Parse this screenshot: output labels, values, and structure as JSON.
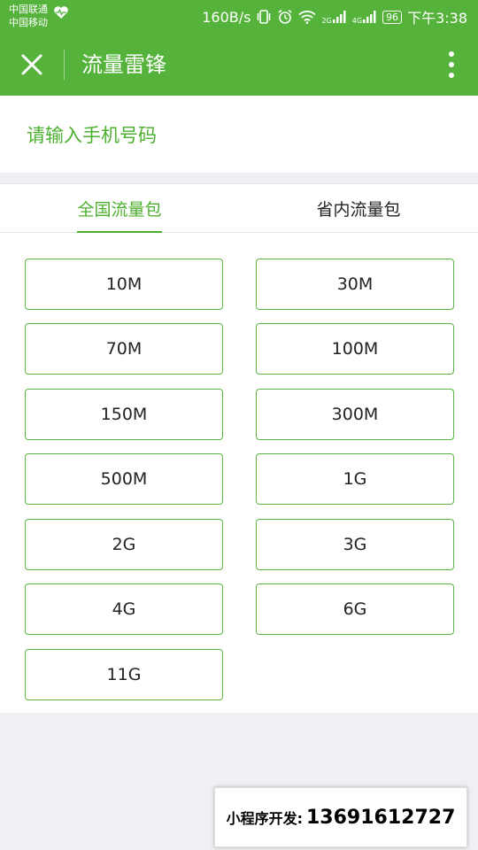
{
  "status_bar": {
    "carrier_1": "中国联通",
    "carrier_2": "中国移动",
    "net_speed": "160B/s",
    "net_type_1": "2G",
    "net_type_2": "4G",
    "battery": "96",
    "time": "下午3:38"
  },
  "navbar": {
    "title": "流量雷锋"
  },
  "phone": {
    "placeholder": "请输入手机号码",
    "value": ""
  },
  "tabs": [
    {
      "label": "全国流量包",
      "active": true
    },
    {
      "label": "省内流量包",
      "active": false
    }
  ],
  "packages": [
    "10M",
    "30M",
    "70M",
    "100M",
    "150M",
    "300M",
    "500M",
    "1G",
    "2G",
    "3G",
    "4G",
    "6G",
    "11G"
  ],
  "watermark": {
    "label": "小程序开发:",
    "phone": "13691612727"
  },
  "colors": {
    "brand_green": "#55b33b",
    "accent_green": "#4caf2f",
    "page_bg": "#efeff4"
  }
}
